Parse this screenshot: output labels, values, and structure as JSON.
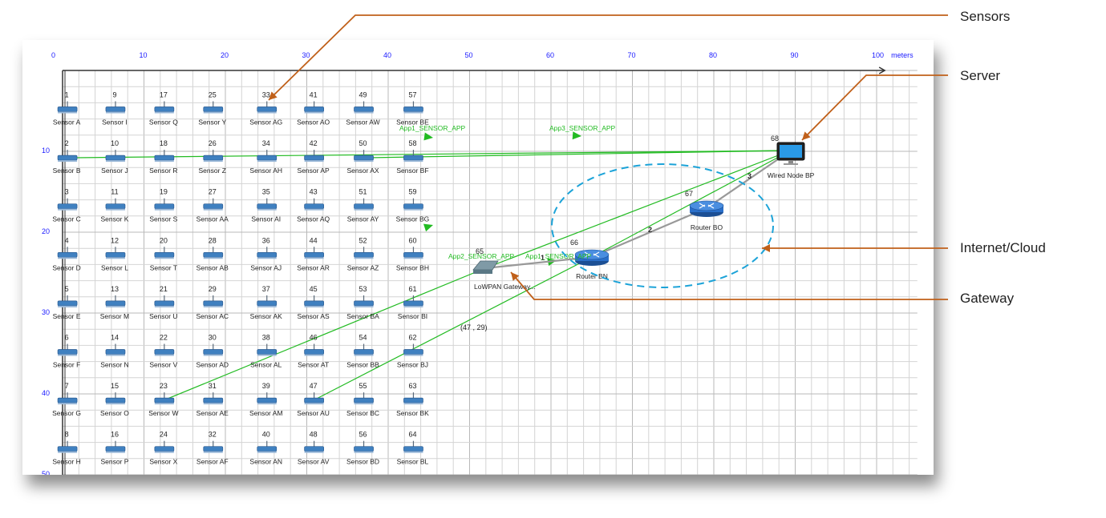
{
  "axis": {
    "unit": "meters",
    "x_ticks": [
      "0",
      "10",
      "20",
      "30",
      "40",
      "50",
      "60",
      "70",
      "80",
      "90",
      "100"
    ],
    "y_ticks": [
      "10",
      "20",
      "30",
      "40",
      "50"
    ]
  },
  "sensors": [
    {
      "id": "1",
      "label": "Sensor A"
    },
    {
      "id": "2",
      "label": "Sensor B"
    },
    {
      "id": "3",
      "label": "Sensor C"
    },
    {
      "id": "4",
      "label": "Sensor D"
    },
    {
      "id": "5",
      "label": "Sensor E"
    },
    {
      "id": "6",
      "label": "Sensor F"
    },
    {
      "id": "7",
      "label": "Sensor G"
    },
    {
      "id": "8",
      "label": "Sensor H"
    },
    {
      "id": "9",
      "label": "Sensor I"
    },
    {
      "id": "10",
      "label": "Sensor J"
    },
    {
      "id": "11",
      "label": "Sensor K"
    },
    {
      "id": "12",
      "label": "Sensor L"
    },
    {
      "id": "13",
      "label": "Sensor M"
    },
    {
      "id": "14",
      "label": "Sensor N"
    },
    {
      "id": "15",
      "label": "Sensor O"
    },
    {
      "id": "16",
      "label": "Sensor P"
    },
    {
      "id": "17",
      "label": "Sensor Q"
    },
    {
      "id": "18",
      "label": "Sensor R"
    },
    {
      "id": "19",
      "label": "Sensor S"
    },
    {
      "id": "20",
      "label": "Sensor T"
    },
    {
      "id": "21",
      "label": "Sensor U"
    },
    {
      "id": "22",
      "label": "Sensor V"
    },
    {
      "id": "23",
      "label": "Sensor W"
    },
    {
      "id": "24",
      "label": "Sensor X"
    },
    {
      "id": "25",
      "label": "Sensor Y"
    },
    {
      "id": "26",
      "label": "Sensor Z"
    },
    {
      "id": "27",
      "label": "Sensor AA"
    },
    {
      "id": "28",
      "label": "Sensor AB"
    },
    {
      "id": "29",
      "label": "Sensor AC"
    },
    {
      "id": "30",
      "label": "Sensor AD"
    },
    {
      "id": "31",
      "label": "Sensor AE"
    },
    {
      "id": "32",
      "label": "Sensor AF"
    },
    {
      "id": "33",
      "label": "Sensor AG"
    },
    {
      "id": "34",
      "label": "Sensor AH"
    },
    {
      "id": "35",
      "label": "Sensor AI"
    },
    {
      "id": "36",
      "label": "Sensor AJ"
    },
    {
      "id": "37",
      "label": "Sensor AK"
    },
    {
      "id": "38",
      "label": "Sensor AL"
    },
    {
      "id": "39",
      "label": "Sensor AM"
    },
    {
      "id": "40",
      "label": "Sensor AN"
    },
    {
      "id": "41",
      "label": "Sensor AO"
    },
    {
      "id": "42",
      "label": "Sensor AP"
    },
    {
      "id": "43",
      "label": "Sensor AQ"
    },
    {
      "id": "44",
      "label": "Sensor AR"
    },
    {
      "id": "45",
      "label": "Sensor AS"
    },
    {
      "id": "46",
      "label": "Sensor AT"
    },
    {
      "id": "47",
      "label": "Sensor AU"
    },
    {
      "id": "48",
      "label": "Sensor AV"
    },
    {
      "id": "49",
      "label": "Sensor AW"
    },
    {
      "id": "50",
      "label": "Sensor AX"
    },
    {
      "id": "51",
      "label": "Sensor AY"
    },
    {
      "id": "52",
      "label": "Sensor AZ"
    },
    {
      "id": "53",
      "label": "Sensor BA"
    },
    {
      "id": "54",
      "label": "Sensor BB"
    },
    {
      "id": "55",
      "label": "Sensor BC"
    },
    {
      "id": "56",
      "label": "Sensor BD"
    },
    {
      "id": "57",
      "label": "Sensor BE"
    },
    {
      "id": "58",
      "label": "Sensor BF"
    },
    {
      "id": "59",
      "label": "Sensor BG"
    },
    {
      "id": "60",
      "label": "Sensor BH"
    },
    {
      "id": "61",
      "label": "Sensor BI"
    },
    {
      "id": "62",
      "label": "Sensor BJ"
    },
    {
      "id": "63",
      "label": "Sensor BK"
    },
    {
      "id": "64",
      "label": "Sensor BL"
    }
  ],
  "gateway": {
    "id": "65",
    "label": "LoWPAN Gateway..."
  },
  "router_bn": {
    "id": "66",
    "label": "Router BN"
  },
  "router_bo": {
    "id": "67",
    "label": "Router BO"
  },
  "server": {
    "id": "68",
    "label": "Wired Node BP"
  },
  "link_labels": [
    "1",
    "2",
    "3"
  ],
  "app_labels": [
    "App1_SENSOR_APP",
    "App2_SENSOR_APP",
    "App3_SENSOR_APP",
    "App1_SENSOR_APP"
  ],
  "coordinate_readout": "(47 , 29)",
  "callouts": {
    "sensors": "Sensors",
    "server": "Server",
    "cloud": "Internet/Cloud",
    "gateway": "Gateway"
  },
  "colors": {
    "grid": "#d4d4d4",
    "major_grid": "#b8b8b8",
    "axis_text": "#1a1aff",
    "flow": "#22bb22",
    "wired_link": "#999999",
    "cloud": "#1ca3d8",
    "callout_line": "#c0601a",
    "router": "#2a6fc9"
  }
}
